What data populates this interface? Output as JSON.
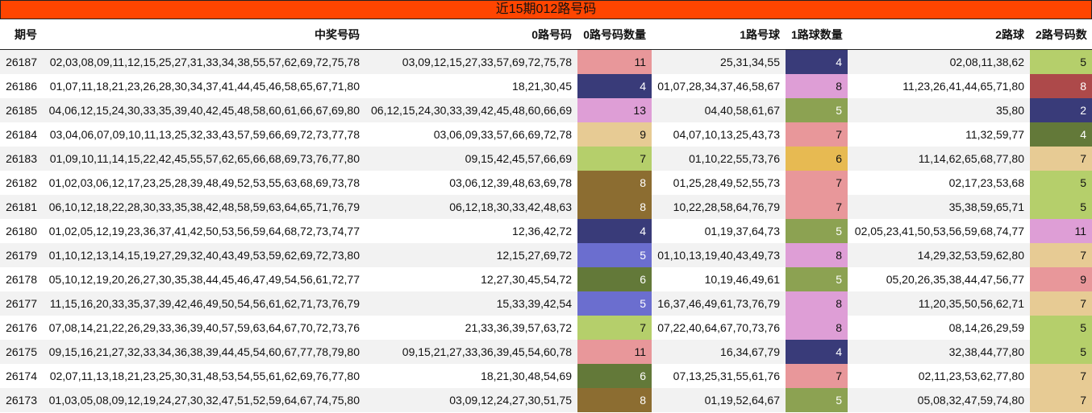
{
  "title": "近15期012路号码",
  "headers": [
    "期号",
    "中奖号码",
    "0路号码",
    "0路号码数量",
    "1路号球",
    "1路球数量",
    "2路球",
    "2路号码数"
  ],
  "rows": [
    {
      "issue": "26187",
      "numbers": "02,03,08,09,11,12,15,25,27,31,33,34,38,55,57,62,69,72,75,78",
      "r0": "03,09,12,15,27,33,57,69,72,75,78",
      "r0n": "11",
      "r0c": "#e8979a",
      "r1": "25,31,34,55",
      "r1n": "4",
      "r1c": "#393b79",
      "r2": "02,08,11,38,62",
      "r2n": "5",
      "r2c": "#b5cf6b"
    },
    {
      "issue": "26186",
      "numbers": "01,07,11,18,21,23,26,28,30,34,37,41,44,45,46,58,65,67,71,80",
      "r0": "18,21,30,45",
      "r0n": "4",
      "r0c": "#393b79",
      "r1": "01,07,28,34,37,46,58,67",
      "r1n": "8",
      "r1c": "#de9ed6",
      "r2": "11,23,26,41,44,65,71,80",
      "r2n": "8",
      "r2c": "#ad494a"
    },
    {
      "issue": "26185",
      "numbers": "04,06,12,15,24,30,33,35,39,40,42,45,48,58,60,61,66,67,69,80",
      "r0": "06,12,15,24,30,33,39,42,45,48,60,66,69",
      "r0n": "13",
      "r0c": "#de9ed6",
      "r1": "04,40,58,61,67",
      "r1n": "5",
      "r1c": "#8ca252",
      "r2": "35,80",
      "r2n": "2",
      "r2c": "#393b79"
    },
    {
      "issue": "26184",
      "numbers": "03,04,06,07,09,10,11,13,25,32,33,43,57,59,66,69,72,73,77,78",
      "r0": "03,06,09,33,57,66,69,72,78",
      "r0n": "9",
      "r0c": "#e7cb94",
      "r1": "04,07,10,13,25,43,73",
      "r1n": "7",
      "r1c": "#e8979a",
      "r2": "11,32,59,77",
      "r2n": "4",
      "r2c": "#637939"
    },
    {
      "issue": "26183",
      "numbers": "01,09,10,11,14,15,22,42,45,55,57,62,65,66,68,69,73,76,77,80",
      "r0": "09,15,42,45,57,66,69",
      "r0n": "7",
      "r0c": "#b5cf6b",
      "r1": "01,10,22,55,73,76",
      "r1n": "6",
      "r1c": "#e7ba52",
      "r2": "11,14,62,65,68,77,80",
      "r2n": "7",
      "r2c": "#e7cb94"
    },
    {
      "issue": "26182",
      "numbers": "01,02,03,06,12,17,23,25,28,39,48,49,52,53,55,63,68,69,73,78",
      "r0": "03,06,12,39,48,63,69,78",
      "r0n": "8",
      "r0c": "#8c6d31",
      "r1": "01,25,28,49,52,55,73",
      "r1n": "7",
      "r1c": "#e8979a",
      "r2": "02,17,23,53,68",
      "r2n": "5",
      "r2c": "#b5cf6b"
    },
    {
      "issue": "26181",
      "numbers": "06,10,12,18,22,28,30,33,35,38,42,48,58,59,63,64,65,71,76,79",
      "r0": "06,12,18,30,33,42,48,63",
      "r0n": "8",
      "r0c": "#8c6d31",
      "r1": "10,22,28,58,64,76,79",
      "r1n": "7",
      "r1c": "#e8979a",
      "r2": "35,38,59,65,71",
      "r2n": "5",
      "r2c": "#b5cf6b"
    },
    {
      "issue": "26180",
      "numbers": "01,02,05,12,19,23,36,37,41,42,50,53,56,59,64,68,72,73,74,77",
      "r0": "12,36,42,72",
      "r0n": "4",
      "r0c": "#393b79",
      "r1": "01,19,37,64,73",
      "r1n": "5",
      "r1c": "#8ca252",
      "r2": "02,05,23,41,50,53,56,59,68,74,77",
      "r2n": "11",
      "r2c": "#de9ed6"
    },
    {
      "issue": "26179",
      "numbers": "01,10,12,13,14,15,19,27,29,32,40,43,49,53,59,62,69,72,73,80",
      "r0": "12,15,27,69,72",
      "r0n": "5",
      "r0c": "#6b6ecf",
      "r1": "01,10,13,19,40,43,49,73",
      "r1n": "8",
      "r1c": "#de9ed6",
      "r2": "14,29,32,53,59,62,80",
      "r2n": "7",
      "r2c": "#e7cb94"
    },
    {
      "issue": "26178",
      "numbers": "05,10,12,19,20,26,27,30,35,38,44,45,46,47,49,54,56,61,72,77",
      "r0": "12,27,30,45,54,72",
      "r0n": "6",
      "r0c": "#637939",
      "r1": "10,19,46,49,61",
      "r1n": "5",
      "r1c": "#8ca252",
      "r2": "05,20,26,35,38,44,47,56,77",
      "r2n": "9",
      "r2c": "#e8979a"
    },
    {
      "issue": "26177",
      "numbers": "11,15,16,20,33,35,37,39,42,46,49,50,54,56,61,62,71,73,76,79",
      "r0": "15,33,39,42,54",
      "r0n": "5",
      "r0c": "#6b6ecf",
      "r1": "16,37,46,49,61,73,76,79",
      "r1n": "8",
      "r1c": "#de9ed6",
      "r2": "11,20,35,50,56,62,71",
      "r2n": "7",
      "r2c": "#e7cb94"
    },
    {
      "issue": "26176",
      "numbers": "07,08,14,21,22,26,29,33,36,39,40,57,59,63,64,67,70,72,73,76",
      "r0": "21,33,36,39,57,63,72",
      "r0n": "7",
      "r0c": "#b5cf6b",
      "r1": "07,22,40,64,67,70,73,76",
      "r1n": "8",
      "r1c": "#de9ed6",
      "r2": "08,14,26,29,59",
      "r2n": "5",
      "r2c": "#b5cf6b"
    },
    {
      "issue": "26175",
      "numbers": "09,15,16,21,27,32,33,34,36,38,39,44,45,54,60,67,77,78,79,80",
      "r0": "09,15,21,27,33,36,39,45,54,60,78",
      "r0n": "11",
      "r0c": "#e8979a",
      "r1": "16,34,67,79",
      "r1n": "4",
      "r1c": "#393b79",
      "r2": "32,38,44,77,80",
      "r2n": "5",
      "r2c": "#b5cf6b"
    },
    {
      "issue": "26174",
      "numbers": "02,07,11,13,18,21,23,25,30,31,48,53,54,55,61,62,69,76,77,80",
      "r0": "18,21,30,48,54,69",
      "r0n": "6",
      "r0c": "#637939",
      "r1": "07,13,25,31,55,61,76",
      "r1n": "7",
      "r1c": "#e8979a",
      "r2": "02,11,23,53,62,77,80",
      "r2n": "7",
      "r2c": "#e7cb94"
    },
    {
      "issue": "26173",
      "numbers": "01,03,05,08,09,12,19,24,27,30,32,47,51,52,59,64,67,74,75,80",
      "r0": "03,09,12,24,27,30,51,75",
      "r0n": "8",
      "r0c": "#8c6d31",
      "r1": "01,19,52,64,67",
      "r1n": "5",
      "r1c": "#8ca252",
      "r2": "05,08,32,47,59,74,80",
      "r2n": "7",
      "r2c": "#e7cb94"
    }
  ]
}
